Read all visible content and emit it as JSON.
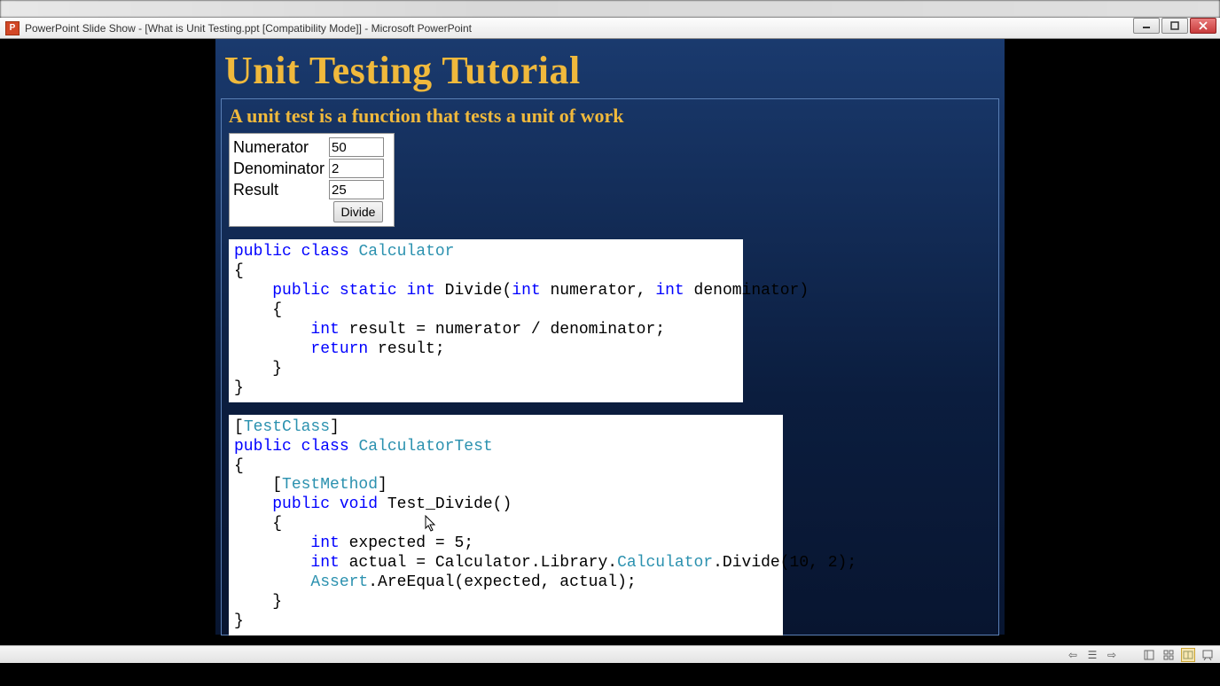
{
  "window": {
    "app_icon_text": "P",
    "title": "PowerPoint Slide Show - [What is Unit Testing.ppt [Compatibility Mode]] - Microsoft PowerPoint"
  },
  "slide": {
    "title": "Unit Testing Tutorial",
    "subtitle": "A unit test is a function that tests a unit of work"
  },
  "form": {
    "numerator": {
      "label": "Numerator",
      "value": "50"
    },
    "denominator": {
      "label": "Denominator",
      "value": "2"
    },
    "result": {
      "label": "Result",
      "value": "25"
    },
    "button_label": "Divide"
  },
  "code1": {
    "l1a": "public",
    "l1b": " ",
    "l1c": "class",
    "l1d": " ",
    "l1e": "Calculator",
    "l2": "{",
    "l3a": "    ",
    "l3b": "public",
    "l3c": " ",
    "l3d": "static",
    "l3e": " ",
    "l3f": "int",
    "l3g": " Divide(",
    "l3h": "int",
    "l3i": " numerator, ",
    "l3j": "int",
    "l3k": " denominator)",
    "l4": "    {",
    "l5a": "        ",
    "l5b": "int",
    "l5c": " result = numerator / denominator;",
    "l6a": "        ",
    "l6b": "return",
    "l6c": " result;",
    "l7": "    }",
    "l8": "}"
  },
  "code2": {
    "l1a": "[",
    "l1b": "TestClass",
    "l1c": "]",
    "l2a": "public",
    "l2b": " ",
    "l2c": "class",
    "l2d": " ",
    "l2e": "CalculatorTest",
    "l3": "{",
    "l4a": "    [",
    "l4b": "TestMethod",
    "l4c": "]",
    "l5a": "    ",
    "l5b": "public",
    "l5c": " ",
    "l5d": "void",
    "l5e": " Test_Divide()",
    "l6": "    {",
    "l7a": "        ",
    "l7b": "int",
    "l7c": " expected = 5;",
    "l8a": "        ",
    "l8b": "int",
    "l8c": " actual = Calculator.Library.",
    "l8d": "Calculator",
    "l8e": ".Divide(10, 2);",
    "l9a": "        ",
    "l9b": "Assert",
    "l9c": ".AreEqual(expected, actual);",
    "l10": "    }",
    "l11": "}"
  },
  "bottombar": {
    "prev": "⇦",
    "menu": "☰",
    "next": "⇨"
  }
}
